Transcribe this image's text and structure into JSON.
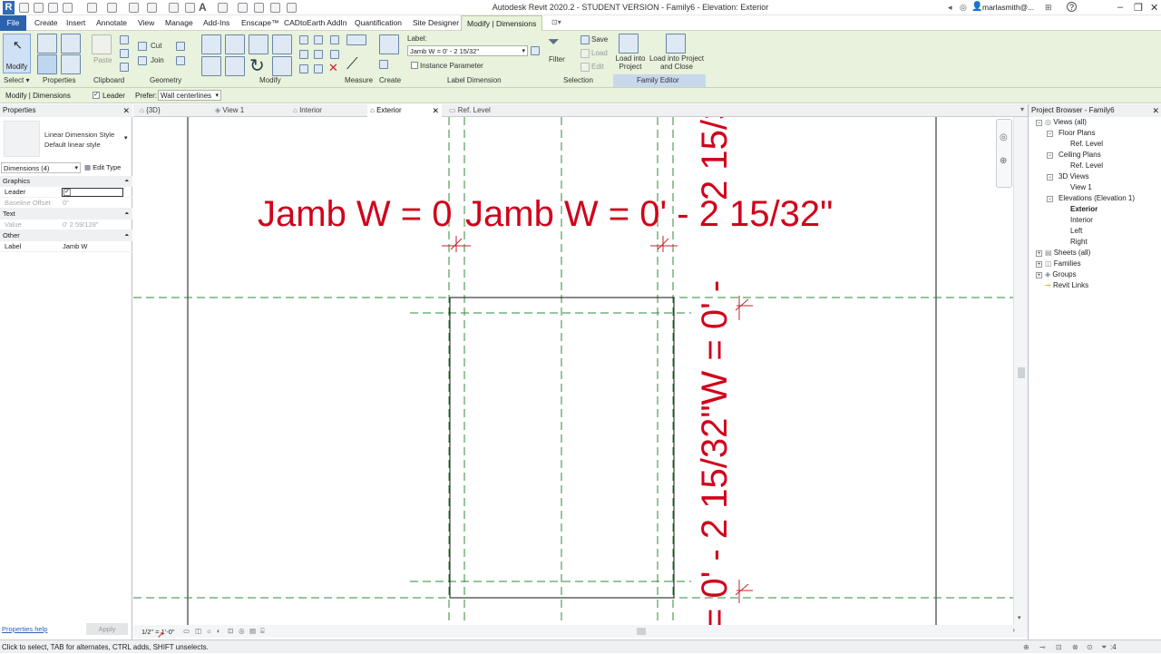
{
  "app": {
    "window_title": "Autodesk Revit 2020.2 - STUDENT VERSION - Family6 - Elevation: Exterior",
    "user": "marlasmith@...",
    "help": "?"
  },
  "ribbon_tabs": [
    "File",
    "Create",
    "Insert",
    "Annotate",
    "View",
    "Manage",
    "Add-Ins",
    "Enscape™",
    "CADtoEarth AddIn",
    "Quantification",
    "Site Designer",
    "Modify | Dimensions"
  ],
  "ribbon": {
    "modify": "Modify",
    "properties": "Properties",
    "clipboard_paste": "Paste",
    "cut": "Cut",
    "join": "Join",
    "label_caption": "Label:",
    "label_value": "Jamb W = 0' - 2 15/32\"",
    "instance_parameter": "Instance Parameter",
    "filter": "Filter",
    "save": "Save",
    "load": "Load",
    "edit": "Edit",
    "load_into_project": "Load into Project",
    "load_into_project_close": "Load into Project and Close",
    "panels": [
      "Select ▾",
      "Properties",
      "Clipboard",
      "Geometry",
      "Modify",
      "Measure",
      "Create",
      "Label Dimension",
      "Selection",
      "Family Editor"
    ]
  },
  "options_bar": {
    "context": "Modify | Dimensions",
    "leader_label": "Leader",
    "prefer_label": "Prefer:",
    "prefer_value": "Wall centerlines"
  },
  "view_tabs": [
    {
      "label": "{3D}"
    },
    {
      "label": "View 1"
    },
    {
      "label": "Interior"
    },
    {
      "label": "Exterior",
      "active": true
    },
    {
      "label": "Ref. Level"
    }
  ],
  "properties": {
    "title": "Properties",
    "type_line1": "Linear Dimension Style",
    "type_line2": "Default linear style",
    "selector": "Dimensions (4)",
    "edit_type": "Edit Type",
    "groups": {
      "graphics": "Graphics",
      "text": "Text",
      "other": "Other"
    },
    "rows": {
      "leader_k": "Leader",
      "baseline_k": "Baseline Offset",
      "baseline_v": "0\"",
      "value_k": "Value",
      "value_v": "0' 2 59/128\"",
      "label_k": "Label",
      "label_v": "Jamb W"
    },
    "help": "Properties help",
    "apply": "Apply"
  },
  "canvas": {
    "dim_text_a": "Jamb W = 0",
    "dim_text_b": "Jamb W = 0' - 2 15/32\"",
    "vertical_text_top": "2 15/32",
    "vertical_text_main": "= 0' - 2 15/32\"W = 0' -",
    "vertical_text_bottom": "0' - 2 15/32\"",
    "dim_color": "#d0021b"
  },
  "project_browser": {
    "title": "Project Browser - Family6",
    "items": {
      "views_all": "Views (all)",
      "floor_plans": "Floor Plans",
      "fp_ref_level": "Ref. Level",
      "ceiling_plans": "Ceiling Plans",
      "cp_ref_level": "Ref. Level",
      "views_3d": "3D Views",
      "view1": "View 1",
      "elevations": "Elevations (Elevation 1)",
      "exterior": "Exterior",
      "interior": "Interior",
      "left": "Left",
      "right": "Right",
      "sheets": "Sheets (all)",
      "families": "Families",
      "groups": "Groups",
      "revit_links": "Revit Links"
    }
  },
  "view_control": {
    "scale": "1/2\" = 1'-0\""
  },
  "status": {
    "message": "Click to select, TAB for alternates, CTRL adds, SHIFT unselects.",
    "filter_count": ":4"
  }
}
